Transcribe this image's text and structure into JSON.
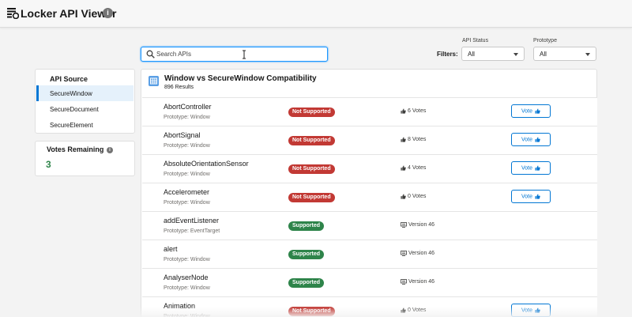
{
  "header": {
    "title": "Locker API Viewer"
  },
  "search": {
    "placeholder": "Search APIs",
    "value": ""
  },
  "filters": {
    "label": "Filters:",
    "api_status": {
      "label": "API Status",
      "value": "All"
    },
    "prototype": {
      "label": "Prototype",
      "value": "All"
    }
  },
  "sidebar": {
    "title": "API Source",
    "items": [
      {
        "label": "SecureWindow",
        "active": true
      },
      {
        "label": "SecureDocument",
        "active": false
      },
      {
        "label": "SecureElement",
        "active": false
      }
    ]
  },
  "votes_remaining": {
    "title": "Votes Remaining",
    "count": "3"
  },
  "main": {
    "title": "Window vs SecureWindow Compatibility",
    "results": "896 Results",
    "vote_label": "Vote",
    "rows": [
      {
        "name": "AbortController",
        "prototype": "Prototype: Window",
        "status": "Not Supported",
        "meta": "6 Votes"
      },
      {
        "name": "AbortSignal",
        "prototype": "Prototype: Window",
        "status": "Not Supported",
        "meta": "8 Votes"
      },
      {
        "name": "AbsoluteOrientationSensor",
        "prototype": "Prototype: Window",
        "status": "Not Supported",
        "meta": "4 Votes"
      },
      {
        "name": "Accelerometer",
        "prototype": "Prototype: Window",
        "status": "Not Supported",
        "meta": "0 Votes"
      },
      {
        "name": "addEventListener",
        "prototype": "Prototype: EventTarget",
        "status": "Supported",
        "meta": "Version 46"
      },
      {
        "name": "alert",
        "prototype": "Prototype: Window",
        "status": "Supported",
        "meta": "Version 46"
      },
      {
        "name": "AnalyserNode",
        "prototype": "Prototype: Window",
        "status": "Supported",
        "meta": "Version 46"
      },
      {
        "name": "Animation",
        "prototype": "Prototype: Window",
        "status": "Not Supported",
        "meta": "0 Votes"
      }
    ]
  },
  "colors": {
    "accent": "#0176d3",
    "supported": "#2e844a",
    "not_supported": "#c23934"
  }
}
